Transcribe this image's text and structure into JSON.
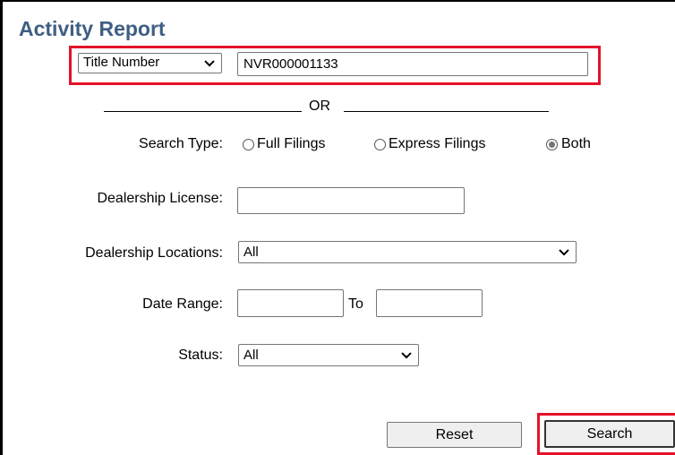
{
  "page": {
    "title": "Activity Report"
  },
  "search_by": {
    "field_select": "Title Number",
    "value": "NVR000001133",
    "or_text": "OR"
  },
  "search_type": {
    "label": "Search Type:",
    "options": [
      {
        "label": "Full Filings",
        "checked": false
      },
      {
        "label": "Express Filings",
        "checked": false
      },
      {
        "label": "Both",
        "checked": true
      }
    ]
  },
  "dealership_license": {
    "label": "Dealership License:",
    "value": ""
  },
  "dealership_locations": {
    "label": "Dealership Locations:",
    "selected": "All"
  },
  "date_range": {
    "label": "Date Range:",
    "from": "",
    "to_label": "To",
    "to": ""
  },
  "status": {
    "label": "Status:",
    "selected": "All"
  },
  "buttons": {
    "reset": "Reset",
    "search": "Search"
  },
  "colors": {
    "title": "#3f5e83",
    "highlight": "#e3132a"
  }
}
